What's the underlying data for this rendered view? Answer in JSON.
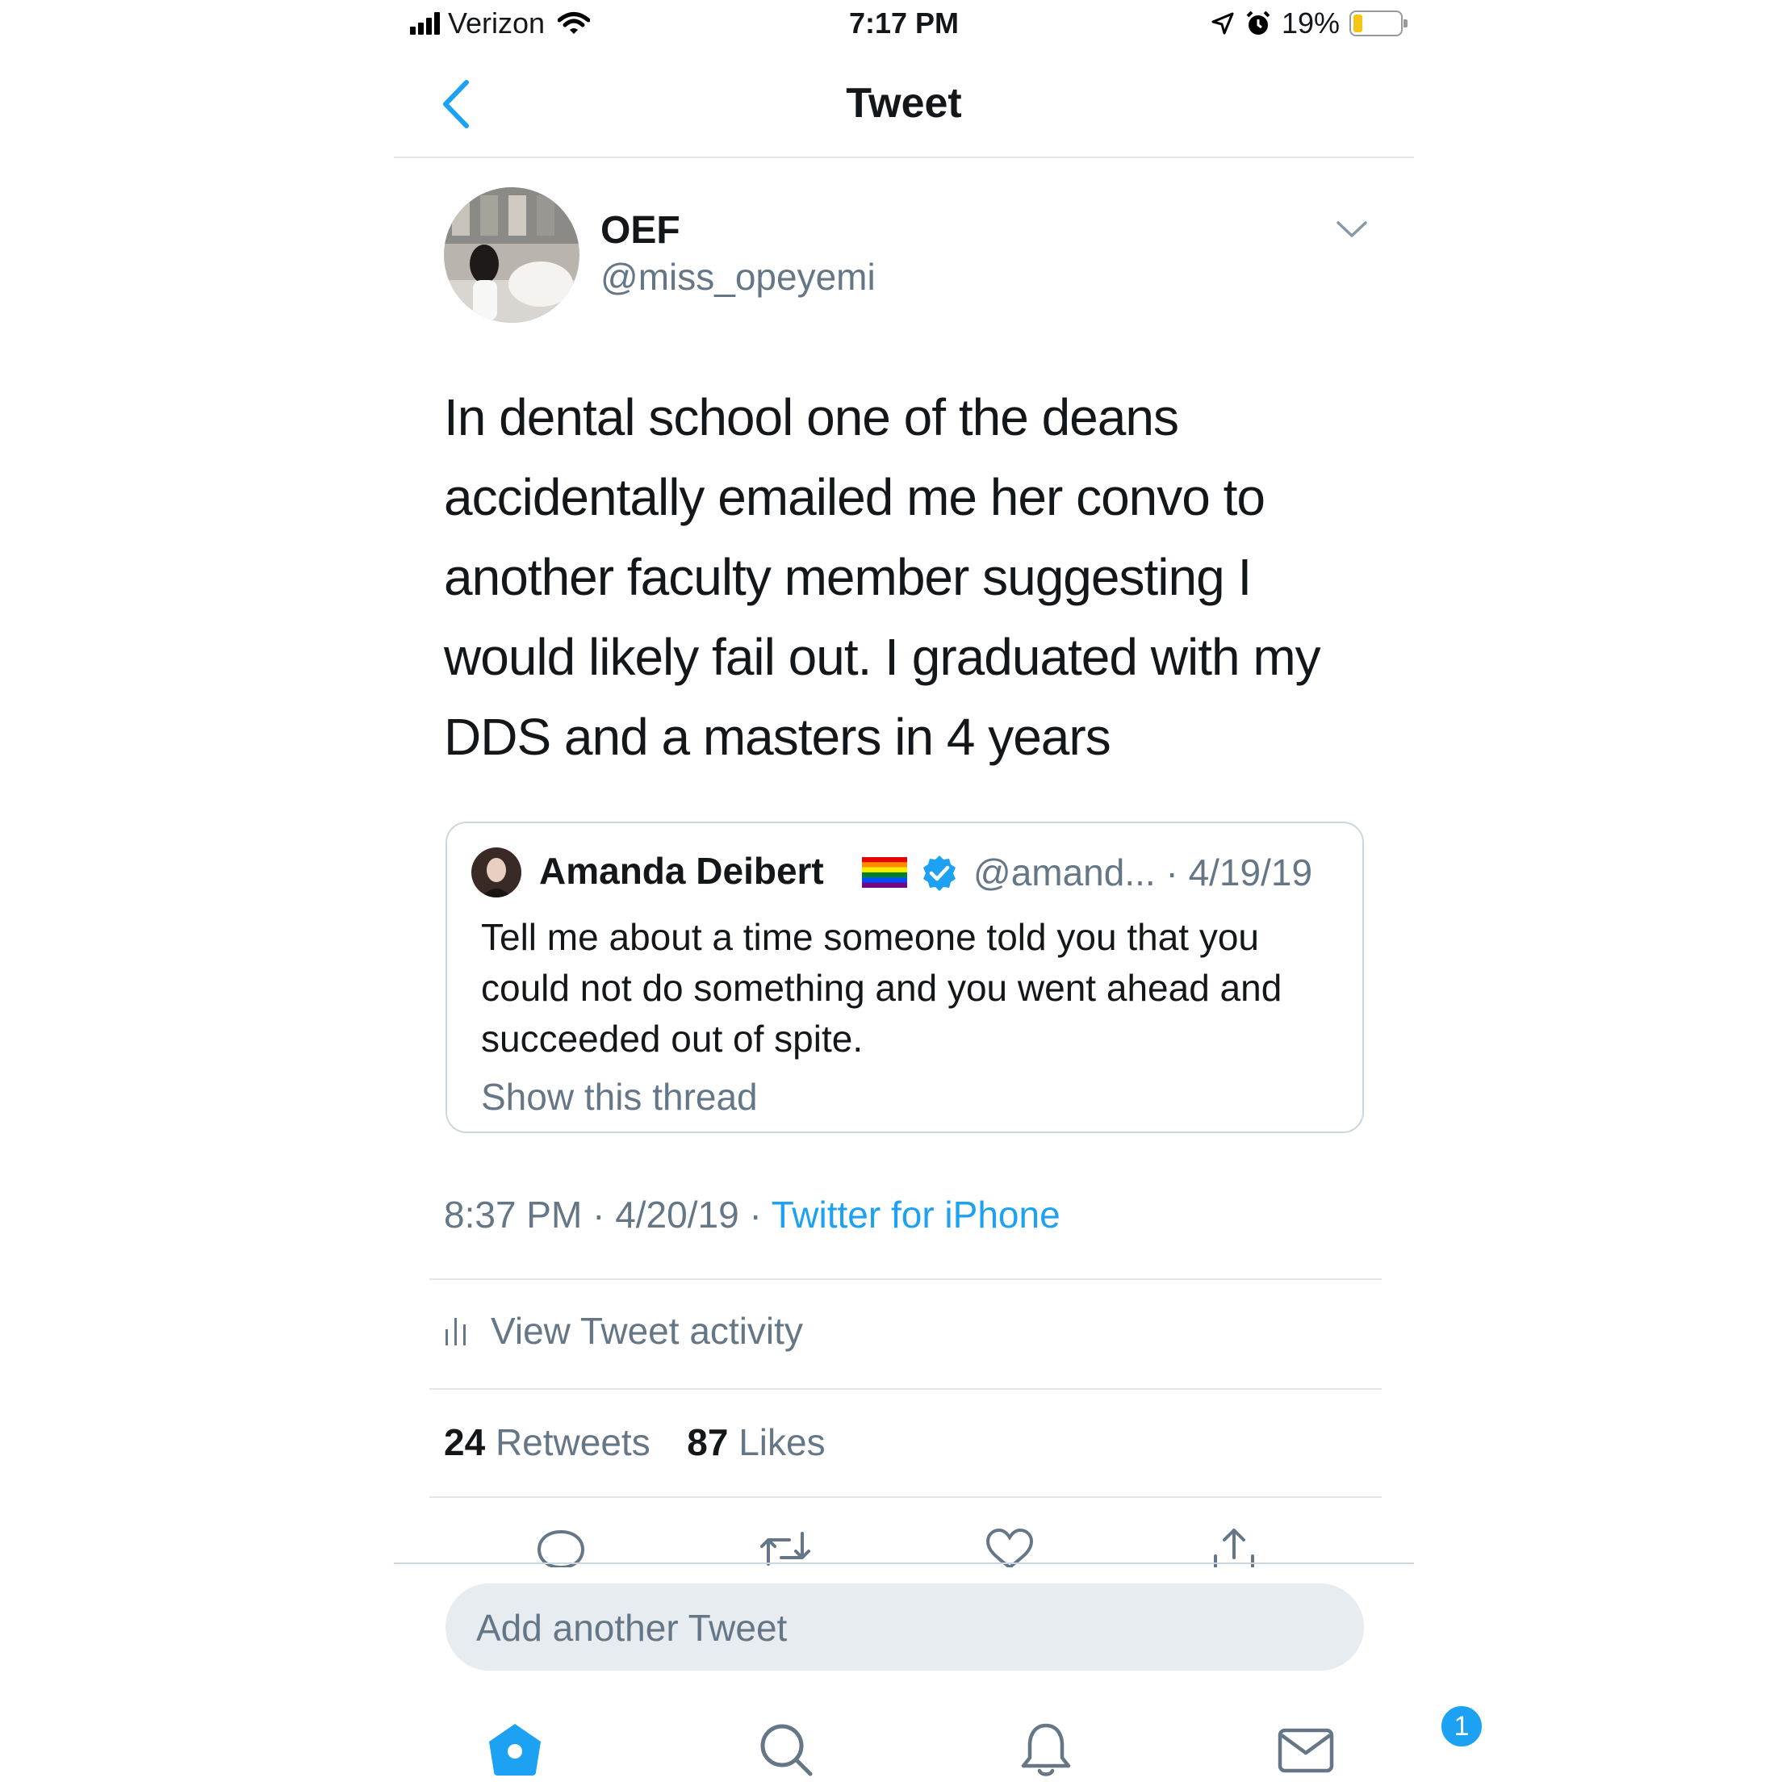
{
  "status_bar": {
    "carrier": "Verizon",
    "time": "7:17 PM",
    "battery_percent": "19%",
    "battery_level": 0.19,
    "battery_color": "#f5c518"
  },
  "nav": {
    "title": "Tweet",
    "back_icon": "chevron-left-icon"
  },
  "tweet": {
    "display_name": "OEF",
    "handle": "@miss_opeyemi",
    "text": "In dental school one of the deans accidentally emailed me her convo to another faculty member suggesting I would likely fail out. I graduated with my DDS and a masters in 4 years",
    "timestamp": "8:37 PM · 4/20/19 · ",
    "source": "Twitter for iPhone",
    "activity_label": "View Tweet activity",
    "retweets": "24",
    "retweets_label": " Retweets",
    "likes": "87",
    "likes_label": " Likes"
  },
  "quoted_tweet": {
    "display_name": "Amanda Deibert",
    "meta": "@amand... · 4/19/19",
    "text": "Tell me about a time someone told you that you could not do something and you went ahead and succeeded out of spite.",
    "thread_link": "Show this thread"
  },
  "compose": {
    "placeholder": "Add another Tweet"
  },
  "tab_bar": {
    "notification_badge": "1"
  },
  "colors": {
    "accent": "#1da1f2",
    "secondary_text": "#657786",
    "divider": "#e1e8ed"
  }
}
